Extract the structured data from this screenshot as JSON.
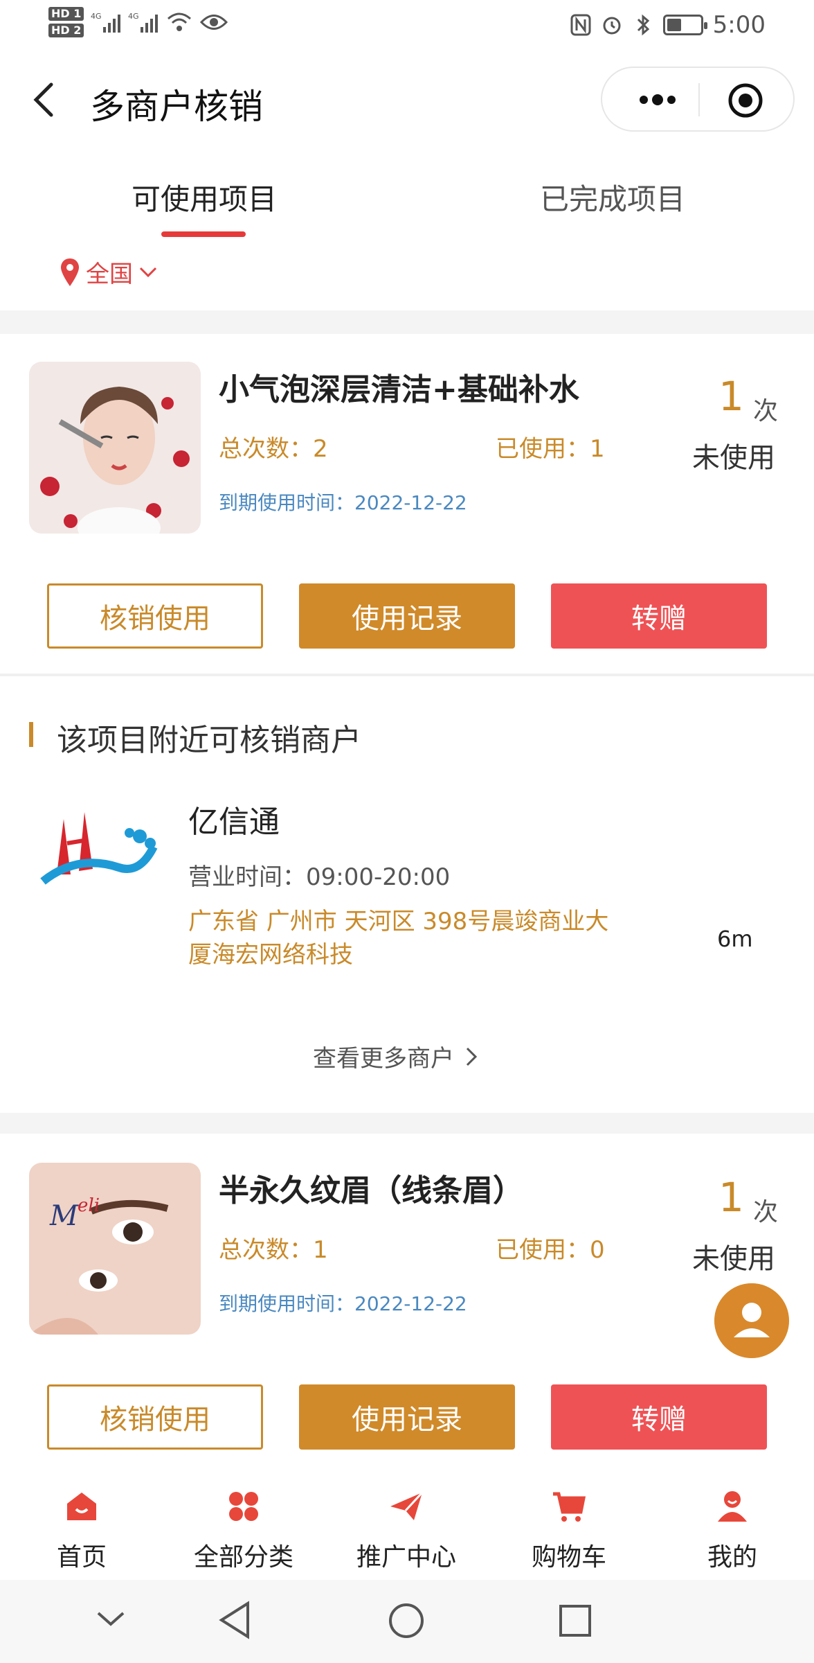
{
  "status_bar": {
    "left_badges": [
      "HD 1",
      "HD 2"
    ],
    "network": "4G",
    "time": "5:00"
  },
  "nav": {
    "title": "多商户核销"
  },
  "tabs": [
    {
      "label": "可使用项目",
      "active": true
    },
    {
      "label": "已完成项目",
      "active": false
    }
  ],
  "region": {
    "label": "全国"
  },
  "items": [
    {
      "title": "小气泡深层清洁+基础补水",
      "total_label": "总次数：",
      "total_value": "2",
      "used_label": "已使用：",
      "used_value": "1",
      "expire_label": "到期使用时间：",
      "expire_value": "2022-12-22",
      "remaining": "1",
      "remaining_unit": "次",
      "status": "未使用",
      "buttons": {
        "verify": "核销使用",
        "record": "使用记录",
        "gift": "转赠"
      }
    },
    {
      "title": "半永久纹眉（线条眉）",
      "total_label": "总次数：",
      "total_value": "1",
      "used_label": "已使用：",
      "used_value": "0",
      "expire_label": "到期使用时间：",
      "expire_value": "2022-12-22",
      "remaining": "1",
      "remaining_unit": "次",
      "status": "未使用",
      "buttons": {
        "verify": "核销使用",
        "record": "使用记录",
        "gift": "转赠"
      }
    }
  ],
  "nearby": {
    "title": "该项目附近可核销商户",
    "merchant": {
      "name": "亿信通",
      "hours_label": "营业时间：",
      "hours_value": "09:00-20:00",
      "address": "广东省 广州市 天河区 398号晨竣商业大厦海宏网络科技",
      "distance": "6m"
    },
    "more_link": "查看更多商户"
  },
  "tabbar": [
    {
      "label": "首页",
      "icon": "home-icon"
    },
    {
      "label": "全部分类",
      "icon": "category-icon"
    },
    {
      "label": "推广中心",
      "icon": "paper-plane-icon"
    },
    {
      "label": "购物车",
      "icon": "cart-icon"
    },
    {
      "label": "我的",
      "icon": "user-icon"
    }
  ],
  "colors": {
    "accent_gold": "#c98a2a",
    "accent_red": "#ef5255",
    "link_blue": "#4a88c0",
    "tab_underline": "#e63a3a"
  }
}
